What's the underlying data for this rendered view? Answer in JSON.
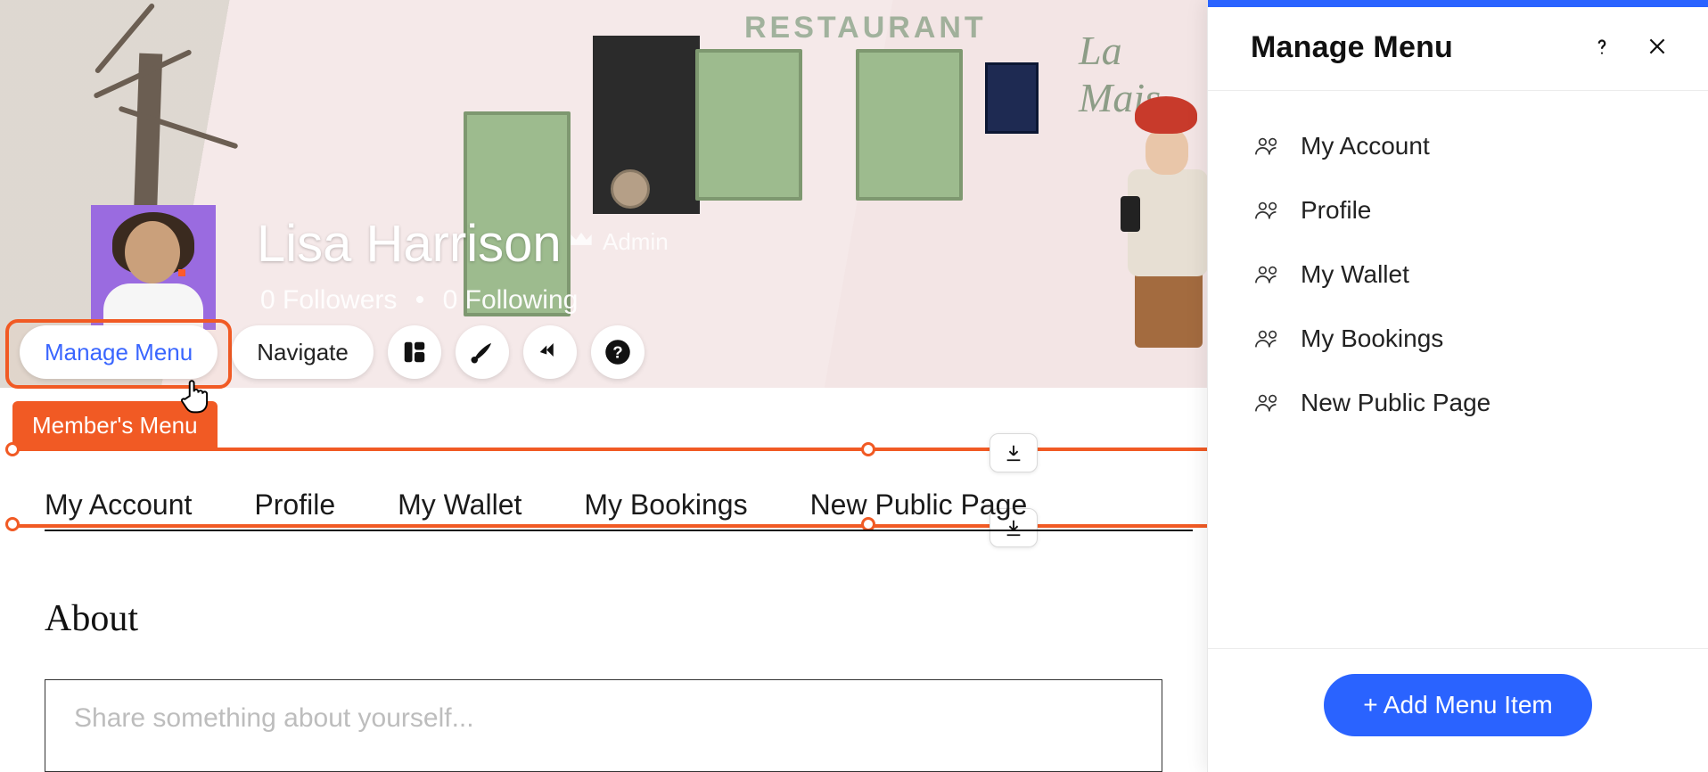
{
  "hero": {
    "sign1": "RESTAURANT",
    "sign2": "La Mais"
  },
  "profile": {
    "name": "Lisa Harrison",
    "role": "Admin",
    "followers_label": "0 Followers",
    "separator": "•",
    "following_label": "0 Following"
  },
  "toolbar": {
    "manage_menu": "Manage Menu",
    "navigate": "Navigate"
  },
  "selection": {
    "tag": "Member's Menu"
  },
  "tabs": [
    "My Account",
    "Profile",
    "My Wallet",
    "My Bookings",
    "New Public Page"
  ],
  "about": {
    "heading": "About",
    "placeholder": "Share something about yourself..."
  },
  "panel": {
    "title": "Manage Menu",
    "items": [
      "My Account",
      "Profile",
      "My Wallet",
      "My Bookings",
      "New Public Page"
    ],
    "add_button": "+ Add Menu Item"
  }
}
